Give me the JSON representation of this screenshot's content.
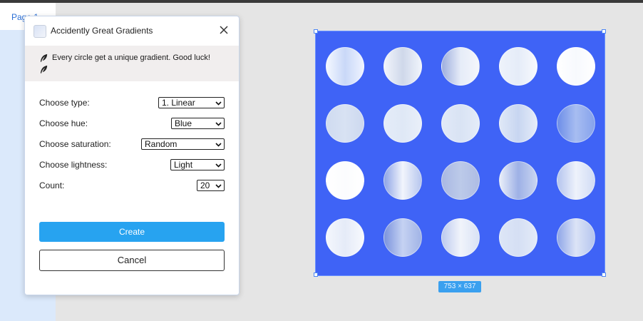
{
  "pages_panel": {
    "page_tab_label": "Page 1"
  },
  "dialog": {
    "title": "Accidently Great Gradients",
    "icons": {
      "app": "plugin-app-icon",
      "close": "close-icon"
    },
    "note": {
      "text": "Every circle get a unique gradient. Good luck!",
      "icon": "feather-icon"
    },
    "fields": {
      "type": {
        "label": "Choose type:",
        "value": "1. Linear"
      },
      "hue": {
        "label": "Choose hue:",
        "value": "Blue"
      },
      "saturation": {
        "label": "Choose saturation:",
        "value": "Random"
      },
      "lightness": {
        "label": "Choose lightness:",
        "value": "Light"
      },
      "count": {
        "label": "Count:",
        "value": "20"
      }
    },
    "create_label": "Create",
    "cancel_label": "Cancel"
  },
  "canvas": {
    "frame_color": "#3f63f6",
    "size_label": "753 × 637",
    "circles": [
      [
        "#f4f8ff",
        "#c9d8f8",
        "#eef3ff"
      ],
      [
        "#f2f5fb",
        "#cfd8ea",
        "#f0f4fb"
      ],
      [
        "#9eaede",
        "#e6ecf8",
        "#f4f6fb"
      ],
      [
        "#eef3fb",
        "#e5ecf8",
        "#f7f9fd"
      ],
      [
        "#ffffff",
        "#f7f9fd",
        "#ffffff"
      ],
      [
        "#cfdbf0",
        "#d8e2f3",
        "#cdd8ef"
      ],
      [
        "#e4ecf8",
        "#dfe8f6",
        "#e9eff9"
      ],
      [
        "#e1e9f7",
        "#d9e3f4",
        "#e4ecf8"
      ],
      [
        "#dfe8f7",
        "#c8d6f1",
        "#e5ecf9"
      ],
      [
        "#6d8ee8",
        "#a7bdf1",
        "#86a2ec"
      ],
      [
        "#ffffff",
        "#fbfcfe",
        "#ffffff"
      ],
      [
        "#8ea4e6",
        "#f2f5fc",
        "#b7c6ee"
      ],
      [
        "#a9b8e3",
        "#bccae9",
        "#aebce4"
      ],
      [
        "#e9eef9",
        "#9eb1e6",
        "#c9d5f1"
      ],
      [
        "#b5c5ee",
        "#eef2fb",
        "#d1dcf5"
      ],
      [
        "#f4f7fd",
        "#e5ebf8",
        "#f7f9fd"
      ],
      [
        "#7b93dd",
        "#c5d2f2",
        "#a1b4e6"
      ],
      [
        "#bccaef",
        "#f1f4fb",
        "#d9e2f5"
      ],
      [
        "#dde6f7",
        "#d5dff4",
        "#e4ebf8"
      ],
      [
        "#8fa6e8",
        "#dce4f6",
        "#b5c5ef"
      ]
    ]
  }
}
